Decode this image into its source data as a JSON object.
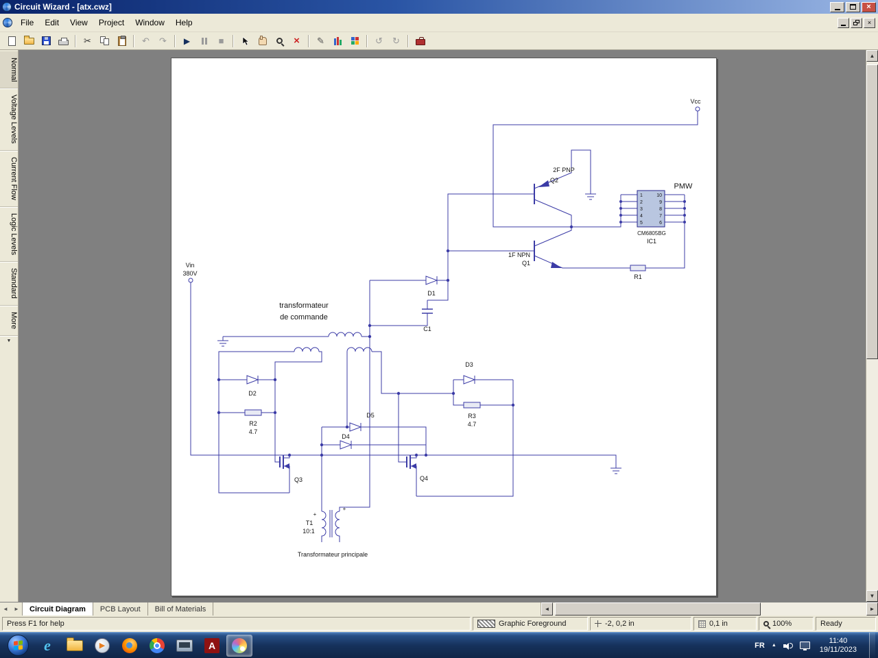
{
  "titlebar": {
    "title": "Circuit Wizard - [atx.cwz]"
  },
  "menus": [
    "File",
    "Edit",
    "View",
    "Project",
    "Window",
    "Help"
  ],
  "toolbar_glyphs": {
    "cut": "✂",
    "undo": "↶",
    "redo": "↷",
    "run": "▶",
    "stop": "■",
    "del": "×",
    "probe": "✎",
    "rot_l": "↺",
    "rot_r": "↻"
  },
  "icons": {
    "close": "×",
    "up": "▲",
    "down": "▼",
    "left": "◄",
    "right": "►",
    "more": "▼",
    "play": "▶"
  },
  "sidebar": [
    "Normal",
    "Voltage Levels",
    "Current Flow",
    "Logic Levels",
    "Standard",
    "More"
  ],
  "sheet_tabs": [
    "Circuit Diagram",
    "PCB Layout",
    "Bill of Materials"
  ],
  "statusbar": {
    "help": "Press F1 for help",
    "layer": "Graphic Foreground",
    "position": "-2, 0,2 in",
    "grid": "0,1 in",
    "zoom": "100%",
    "state": "Ready"
  },
  "taskbar_icons": {
    "ie": "e",
    "adobe": "A"
  },
  "tray": {
    "language": "FR",
    "time": "11:40",
    "date": "19/11/2023"
  },
  "schematic": {
    "labels": {
      "vcc": "Vcc",
      "pmw": "PMW",
      "q2_type": "2F PNP",
      "q2": "Q2",
      "q1_type": "1F NPN",
      "q1": "Q1",
      "ic_name": "CM6805BG",
      "ic_ref": "IC1",
      "r1": "R1",
      "d1": "D1",
      "c1": "C1",
      "ctrl_line1": "transformateur",
      "ctrl_line2": "de commande",
      "vin": "Vin",
      "vin_value": "380V",
      "d2": "D2",
      "r2": "R2",
      "r2_value": "4.7",
      "d3": "D3",
      "r3": "R3",
      "r3_value": "4.7",
      "d4": "D4",
      "d5": "D5",
      "q3": "Q3",
      "q4": "Q4",
      "t1": "T1",
      "t1_ratio": "10:1",
      "t1_caption": "Transformateur principale",
      "plus": "+"
    },
    "pins_left": [
      "1",
      "2",
      "3",
      "4",
      "5"
    ],
    "pins_right": [
      "10",
      "9",
      "8",
      "7",
      "6"
    ]
  }
}
